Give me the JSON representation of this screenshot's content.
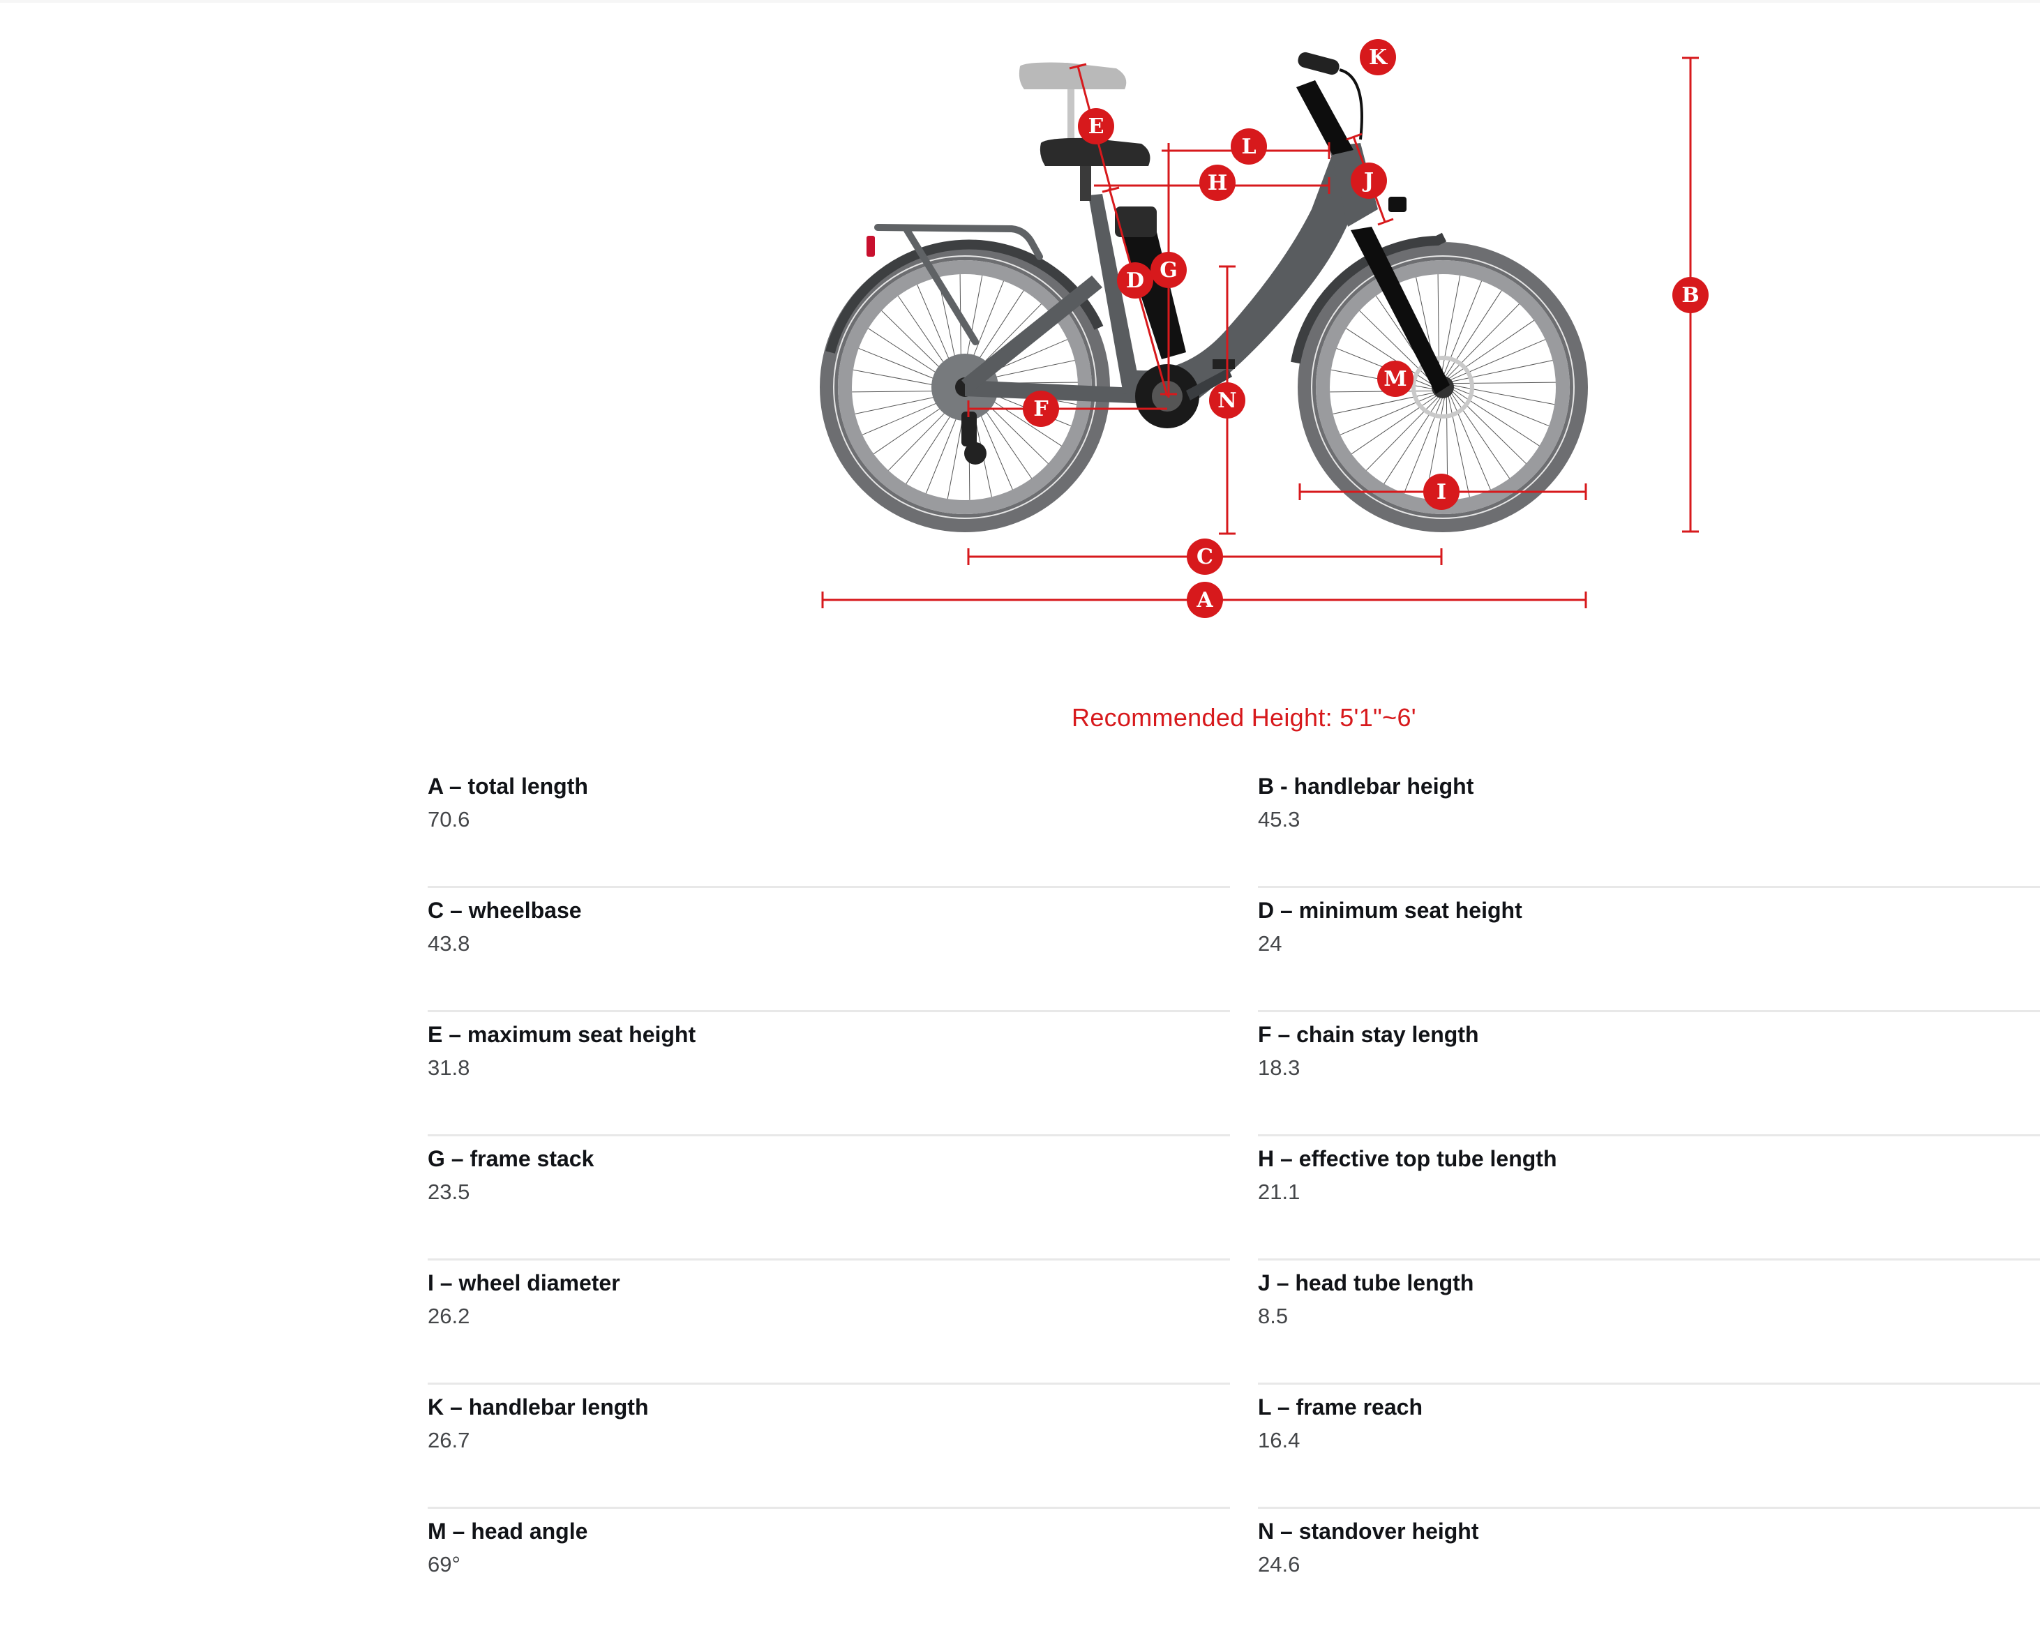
{
  "diagram": {
    "title": "bike-geometry-diagram",
    "accent_color": "#d7191c",
    "frame_color": "#595c5f",
    "tire_color": "#6d6e71",
    "markers": [
      "A",
      "B",
      "C",
      "D",
      "E",
      "F",
      "G",
      "H",
      "I",
      "J",
      "K",
      "L",
      "M",
      "N"
    ]
  },
  "recommended_height": "Recommended Height: 5'1\"~6'",
  "specs": [
    {
      "label": "A – total length",
      "value": "70.6"
    },
    {
      "label": "B - handlebar height",
      "value": "45.3"
    },
    {
      "label": "C – wheelbase",
      "value": "43.8"
    },
    {
      "label": "D – minimum seat height",
      "value": "24"
    },
    {
      "label": "E – maximum seat height",
      "value": "31.8"
    },
    {
      "label": "F – chain stay length",
      "value": "18.3"
    },
    {
      "label": "G – frame stack",
      "value": "23.5"
    },
    {
      "label": "H – effective top tube length",
      "value": "21.1"
    },
    {
      "label": "I – wheel diameter",
      "value": "26.2"
    },
    {
      "label": "J – head tube length",
      "value": "8.5"
    },
    {
      "label": "K – handlebar length",
      "value": "26.7"
    },
    {
      "label": "L – frame reach",
      "value": "16.4"
    },
    {
      "label": "M – head angle",
      "value": "69°"
    },
    {
      "label": "N – standover height",
      "value": "24.6"
    }
  ]
}
